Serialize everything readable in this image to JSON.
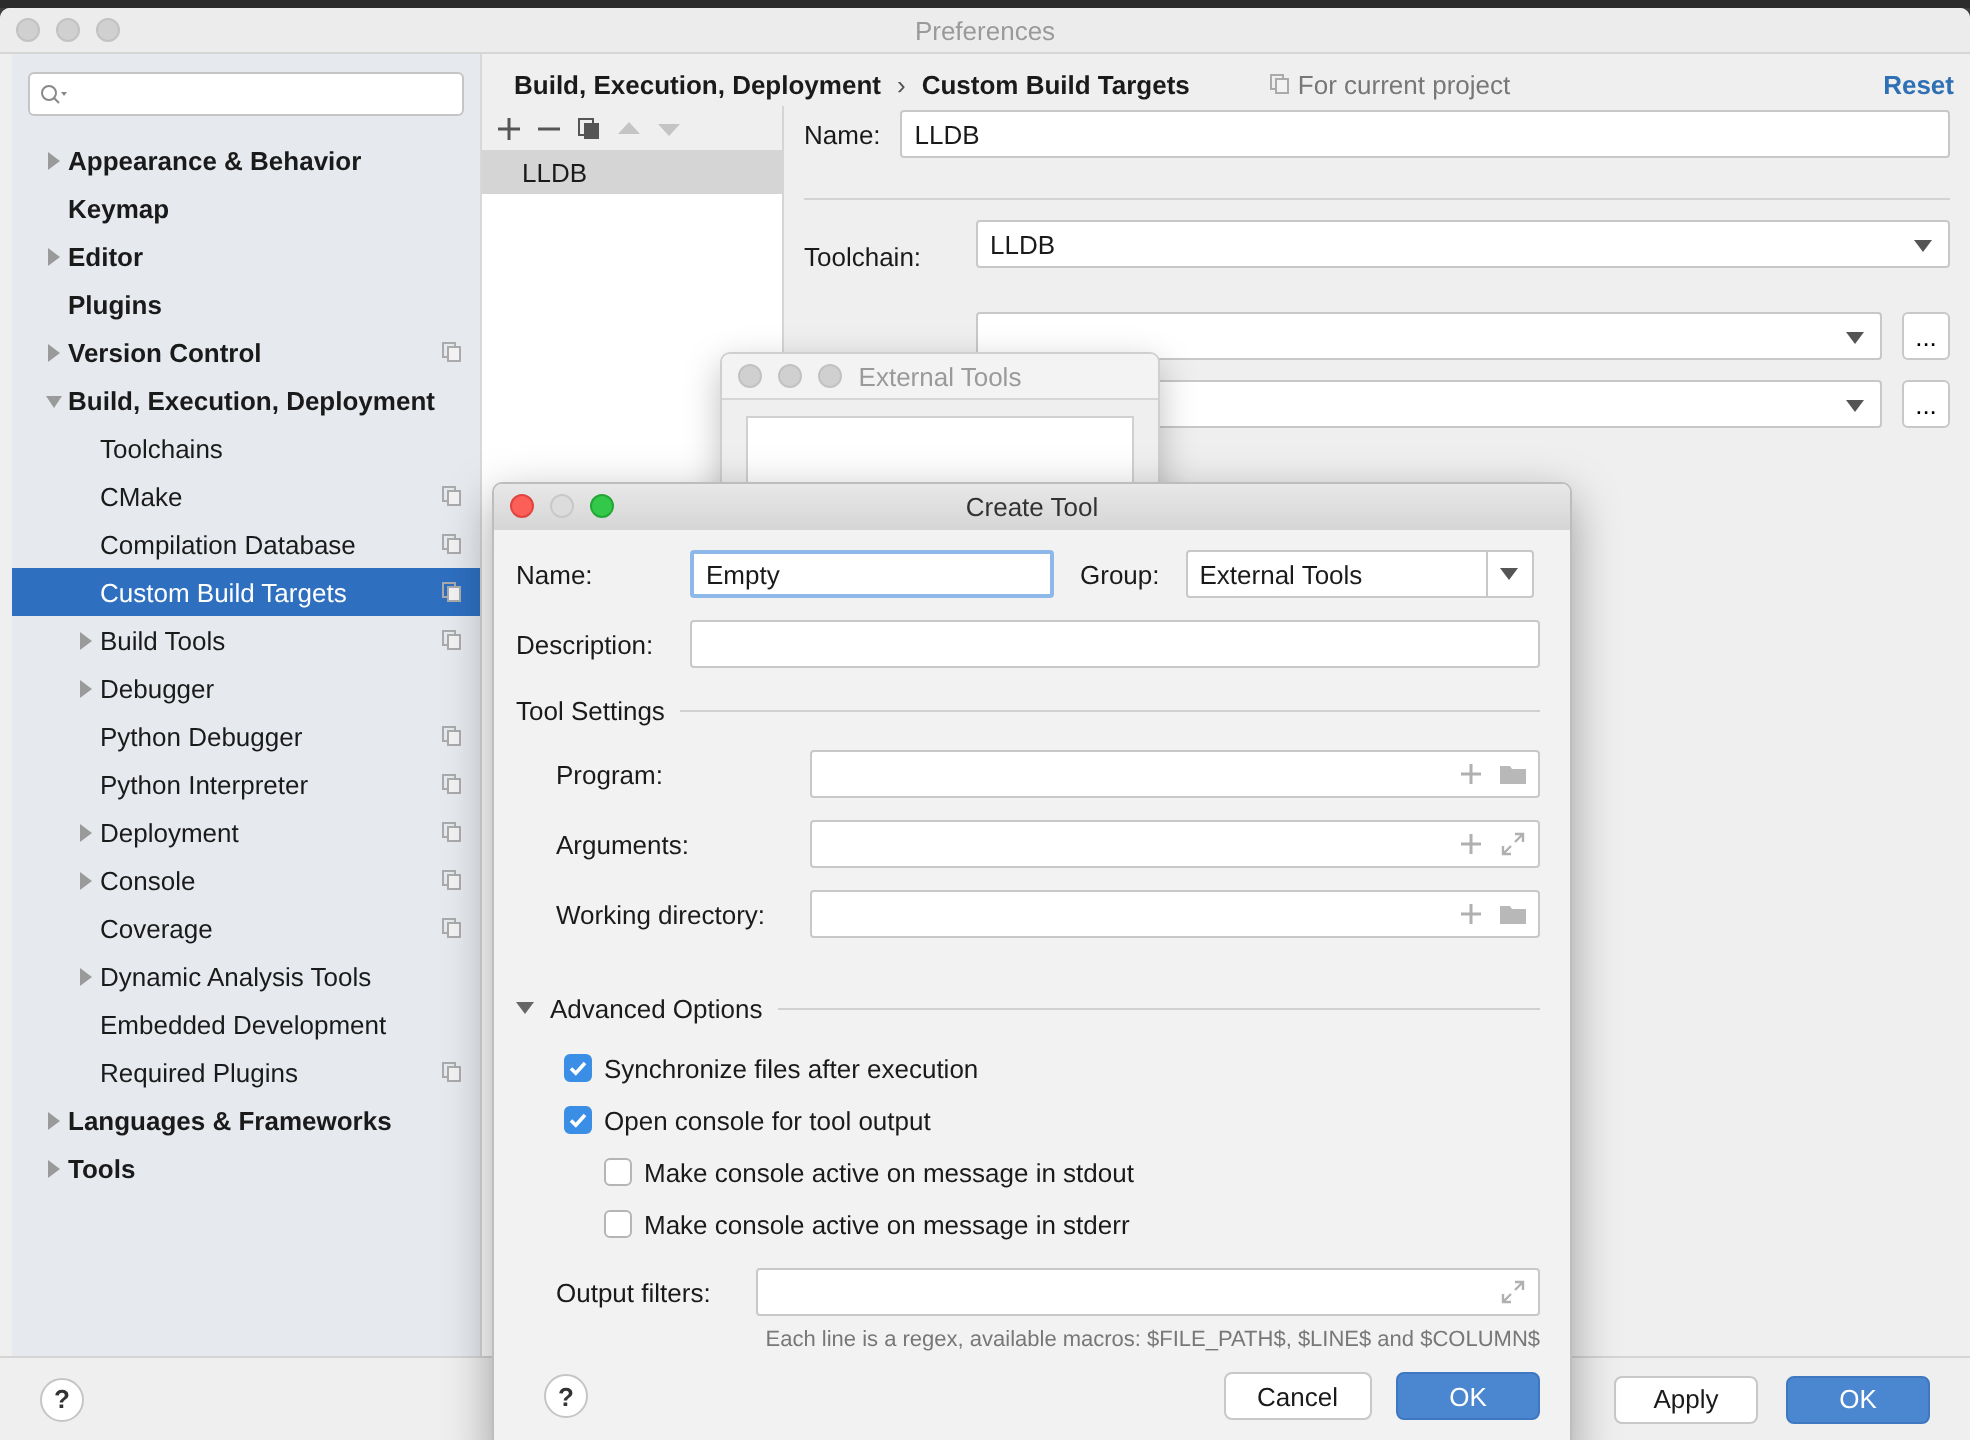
{
  "preferences": {
    "title": "Preferences",
    "tree": [
      {
        "label": "Appearance & Behavior",
        "expandable": true,
        "expanded": false,
        "project_scope": false,
        "selected": false
      },
      {
        "label": "Keymap",
        "expandable": false,
        "expanded": false,
        "project_scope": false,
        "selected": false
      },
      {
        "label": "Editor",
        "expandable": true,
        "expanded": false,
        "project_scope": false,
        "selected": false
      },
      {
        "label": "Plugins",
        "expandable": false,
        "expanded": false,
        "project_scope": false,
        "selected": false
      },
      {
        "label": "Version Control",
        "expandable": true,
        "expanded": false,
        "project_scope": true,
        "selected": false
      },
      {
        "label": "Build, Execution, Deployment",
        "expandable": true,
        "expanded": true,
        "project_scope": false,
        "selected": false,
        "children": [
          {
            "label": "Toolchains",
            "expandable": false,
            "expanded": false,
            "project_scope": false,
            "selected": false
          },
          {
            "label": "CMake",
            "expandable": false,
            "expanded": false,
            "project_scope": true,
            "selected": false
          },
          {
            "label": "Compilation Database",
            "expandable": false,
            "expanded": false,
            "project_scope": true,
            "selected": false
          },
          {
            "label": "Custom Build Targets",
            "expandable": false,
            "expanded": false,
            "project_scope": true,
            "selected": true
          },
          {
            "label": "Build Tools",
            "expandable": true,
            "expanded": false,
            "project_scope": true,
            "selected": false
          },
          {
            "label": "Debugger",
            "expandable": true,
            "expanded": false,
            "project_scope": false,
            "selected": false
          },
          {
            "label": "Python Debugger",
            "expandable": false,
            "expanded": false,
            "project_scope": true,
            "selected": false
          },
          {
            "label": "Python Interpreter",
            "expandable": false,
            "expanded": false,
            "project_scope": true,
            "selected": false
          },
          {
            "label": "Deployment",
            "expandable": true,
            "expanded": false,
            "project_scope": true,
            "selected": false
          },
          {
            "label": "Console",
            "expandable": true,
            "expanded": false,
            "project_scope": true,
            "selected": false
          },
          {
            "label": "Coverage",
            "expandable": false,
            "expanded": false,
            "project_scope": true,
            "selected": false
          },
          {
            "label": "Dynamic Analysis Tools",
            "expandable": true,
            "expanded": false,
            "project_scope": false,
            "selected": false
          },
          {
            "label": "Embedded Development",
            "expandable": false,
            "expanded": false,
            "project_scope": false,
            "selected": false
          },
          {
            "label": "Required Plugins",
            "expandable": false,
            "expanded": false,
            "project_scope": true,
            "selected": false
          }
        ]
      },
      {
        "label": "Languages & Frameworks",
        "expandable": true,
        "expanded": false,
        "project_scope": false,
        "selected": false
      },
      {
        "label": "Tools",
        "expandable": true,
        "expanded": false,
        "project_scope": false,
        "selected": false
      }
    ],
    "breadcrumb": [
      "Build, Execution, Deployment",
      "Custom Build Targets"
    ],
    "breadcrumb_separator": "›",
    "help": "?",
    "scope": "For current project",
    "reset": "Reset",
    "targets": [
      {
        "label": "LLDB",
        "selected": true
      }
    ],
    "name_label": "Name:",
    "name_value": "LLDB",
    "toolchain_label": "Toolchain:",
    "toolchain_value": "LLDB",
    "more_buttons": [
      "...",
      "..."
    ],
    "buttons": [
      {
        "label": "Apply",
        "kind": "normal"
      },
      {
        "label": "OK",
        "kind": "default"
      }
    ]
  },
  "external_tools": {
    "title": "External Tools"
  },
  "create_tool": {
    "title": "Create Tool",
    "name_label": "Name:",
    "name_value": "Empty",
    "group_label": "Group:",
    "group_value": "External Tools",
    "description_label": "Description:",
    "tool_settings": "Tool Settings",
    "fields": [
      {
        "label": "Program:",
        "kind": "path"
      },
      {
        "label": "Arguments:",
        "kind": "text"
      },
      {
        "label": "Working directory:",
        "kind": "path"
      }
    ],
    "advanced": {
      "title": "Advanced Options",
      "expanded": true
    },
    "options": [
      {
        "label": "Synchronize files after execution",
        "checked": true
      },
      {
        "label": "Open console for tool output",
        "checked": true,
        "children": [
          {
            "label": "Make console active on message in stdout",
            "checked": false
          },
          {
            "label": "Make console active on message in stderr",
            "checked": false
          }
        ]
      }
    ],
    "output_filters_label": "Output filters:",
    "help": "?",
    "hint": "Each line is a regex, available macros: $FILE_PATH$, $LINE$ and $COLUMN$",
    "buttons": [
      {
        "label": "Cancel",
        "kind": "normal"
      },
      {
        "label": "OK",
        "kind": "default"
      }
    ]
  }
}
